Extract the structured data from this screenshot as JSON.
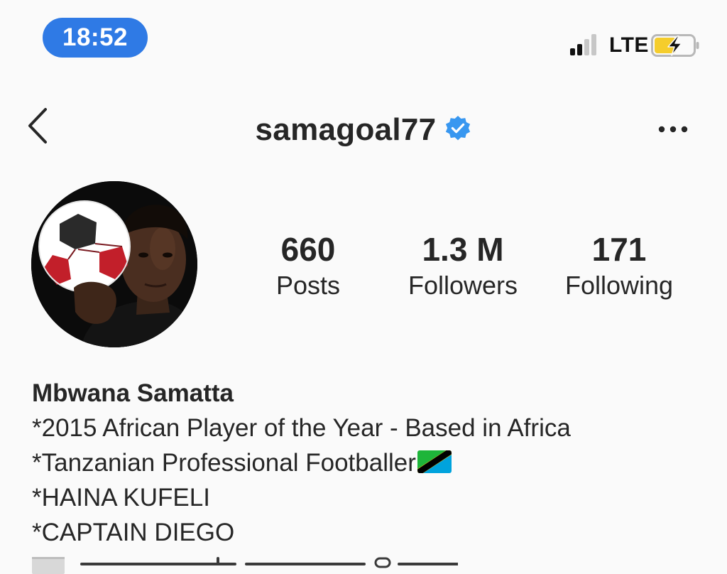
{
  "status_bar": {
    "time": "18:52",
    "network": "LTE",
    "time_pill_color": "#2f7ae5",
    "battery_color": "#f5cd2c",
    "battery_state": "charging"
  },
  "navbar": {
    "back_icon": "chevron-left-icon",
    "username": "samagoal77",
    "verified_icon": "verified-badge-icon",
    "verified_color": "#3897f0",
    "more_icon": "more-horizontal-icon"
  },
  "profile": {
    "avatar_icon": "profile-avatar",
    "stats": [
      {
        "value": "660",
        "label": "Posts"
      },
      {
        "value": "1.3 M",
        "label": "Followers"
      },
      {
        "value": "171",
        "label": "Following"
      }
    ]
  },
  "bio": {
    "name": "Mbwana Samatta",
    "lines": [
      "*2015 African Player of the Year - Based in Africa",
      "*Tanzanian Professional Footballer",
      "*HAINA KUFELI",
      "*CAPTAIN DIEGO"
    ],
    "flag_icon": "tanzania-flag-icon"
  }
}
